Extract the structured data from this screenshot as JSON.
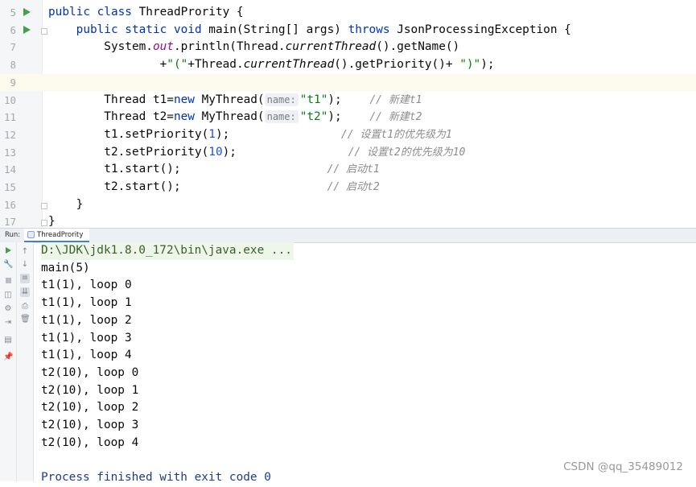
{
  "editor": {
    "lines": [
      {
        "num": "5",
        "run": true,
        "fold": false,
        "current": false,
        "segs": [
          {
            "t": "public class ",
            "c": "kw"
          },
          {
            "t": "ThreadPrority {",
            "c": ""
          }
        ]
      },
      {
        "num": "6",
        "run": true,
        "fold": true,
        "current": false,
        "segs": [
          {
            "t": "    public static void ",
            "c": "kw"
          },
          {
            "t": "main(String[] args) ",
            "c": ""
          },
          {
            "t": "throws ",
            "c": "kw"
          },
          {
            "t": "JsonProcessingException {",
            "c": ""
          }
        ]
      },
      {
        "num": "7",
        "run": false,
        "fold": false,
        "current": false,
        "segs": [
          {
            "t": "        System.",
            "c": ""
          },
          {
            "t": "out",
            "c": "static-field"
          },
          {
            "t": ".println(Thread.",
            "c": ""
          },
          {
            "t": "currentThread",
            "c": "method-italic"
          },
          {
            "t": "().getName()",
            "c": ""
          }
        ]
      },
      {
        "num": "8",
        "run": false,
        "fold": false,
        "current": false,
        "segs": [
          {
            "t": "                +",
            "c": ""
          },
          {
            "t": "\"(\"",
            "c": "str"
          },
          {
            "t": "+Thread.",
            "c": ""
          },
          {
            "t": "currentThread",
            "c": "method-italic"
          },
          {
            "t": "().getPriority()+ ",
            "c": ""
          },
          {
            "t": "\")\"",
            "c": "str"
          },
          {
            "t": ");",
            "c": ""
          }
        ]
      },
      {
        "num": "9",
        "run": false,
        "fold": false,
        "current": true,
        "segs": []
      },
      {
        "num": "10",
        "run": false,
        "fold": false,
        "current": false,
        "segs": [
          {
            "t": "        Thread t1=",
            "c": ""
          },
          {
            "t": "new ",
            "c": "kw"
          },
          {
            "t": "MyThread(",
            "c": ""
          },
          {
            "t": "name:",
            "c": "hint"
          },
          {
            "t": "\"t1\"",
            "c": "str"
          },
          {
            "t": ");    ",
            "c": ""
          },
          {
            "t": "// 新建t1",
            "c": "cmt"
          }
        ]
      },
      {
        "num": "11",
        "run": false,
        "fold": false,
        "current": false,
        "segs": [
          {
            "t": "        Thread t2=",
            "c": ""
          },
          {
            "t": "new ",
            "c": "kw"
          },
          {
            "t": "MyThread(",
            "c": ""
          },
          {
            "t": "name:",
            "c": "hint"
          },
          {
            "t": "\"t2\"",
            "c": "str"
          },
          {
            "t": ");    ",
            "c": ""
          },
          {
            "t": "// 新建t2",
            "c": "cmt"
          }
        ]
      },
      {
        "num": "12",
        "run": false,
        "fold": false,
        "current": false,
        "segs": [
          {
            "t": "        t1.setPriority(",
            "c": ""
          },
          {
            "t": "1",
            "c": "num"
          },
          {
            "t": ");                ",
            "c": ""
          },
          {
            "t": "// 设置t1的优先级为1",
            "c": "cmt"
          }
        ]
      },
      {
        "num": "13",
        "run": false,
        "fold": false,
        "current": false,
        "segs": [
          {
            "t": "        t2.setPriority(",
            "c": ""
          },
          {
            "t": "10",
            "c": "num"
          },
          {
            "t": ");                ",
            "c": ""
          },
          {
            "t": "// 设置t2的优先级为10",
            "c": "cmt"
          }
        ]
      },
      {
        "num": "14",
        "run": false,
        "fold": false,
        "current": false,
        "segs": [
          {
            "t": "        t1.start();                     ",
            "c": ""
          },
          {
            "t": "// 启动t1",
            "c": "cmt"
          }
        ]
      },
      {
        "num": "15",
        "run": false,
        "fold": false,
        "current": false,
        "segs": [
          {
            "t": "        t2.start();                     ",
            "c": ""
          },
          {
            "t": "// 启动t2",
            "c": "cmt"
          }
        ]
      },
      {
        "num": "16",
        "run": false,
        "fold": true,
        "current": false,
        "segs": [
          {
            "t": "    }",
            "c": ""
          }
        ]
      },
      {
        "num": "17",
        "run": false,
        "fold": true,
        "current": false,
        "segs": [
          {
            "t": "}",
            "c": ""
          }
        ]
      }
    ]
  },
  "run_panel": {
    "label": "Run:",
    "tab_label": "ThreadPrority"
  },
  "console": {
    "command": "D:\\JDK\\jdk1.8.0_172\\bin\\java.exe ...",
    "output": [
      "main(5)",
      "t1(1), loop 0",
      "t1(1), loop 1",
      "t1(1), loop 2",
      "t1(1), loop 3",
      "t1(1), loop 4",
      "t2(10), loop 0",
      "t2(10), loop 1",
      "t2(10), loop 2",
      "t2(10), loop 3",
      "t2(10), loop 4",
      ""
    ],
    "finish": "Process finished with exit code 0"
  },
  "toolbar_left": [
    "rerun-icon",
    "wrench-icon",
    "stop-icon",
    "camera-icon",
    "dump-threads-icon",
    "exit-icon",
    "layout-icon",
    "pin-icon"
  ],
  "toolbar_right": [
    "up-arrow-icon",
    "down-arrow-icon",
    "soft-wrap-icon",
    "scroll-to-end-icon",
    "print-icon",
    "trash-icon"
  ],
  "watermark": "CSDN @qq_35489012"
}
